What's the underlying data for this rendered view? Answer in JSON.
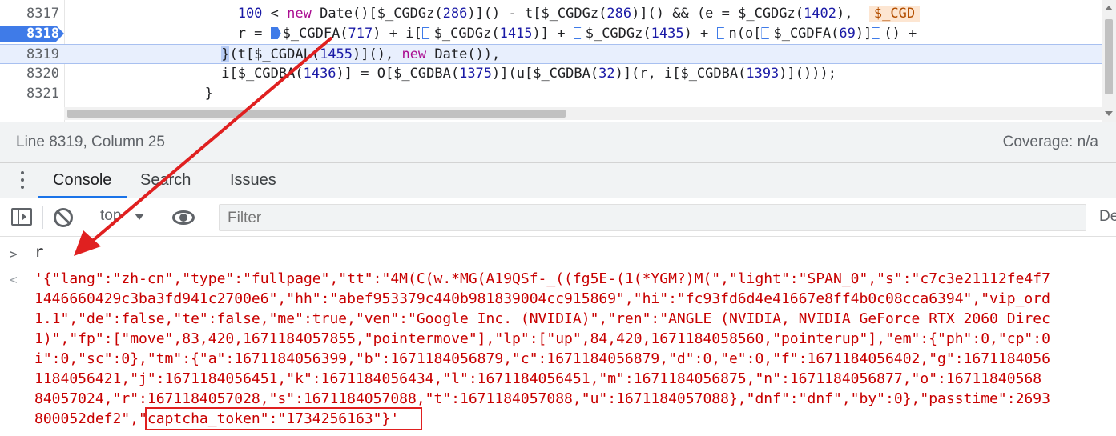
{
  "editor": {
    "lines": [
      {
        "number": "8317"
      },
      {
        "number": "8318"
      },
      {
        "number": "8319"
      },
      {
        "number": "8320"
      },
      {
        "number": "8321"
      }
    ],
    "code_8317": {
      "indent": "                    ",
      "n100": "100",
      "p1": " < ",
      "kw_new": "new",
      "p2": " Date()[$_CGDGz(",
      "n286a": "286",
      "p3": ")]() - t[$_CGDGz(",
      "n286b": "286",
      "p4": ")]() && (e = $_CGDGz(",
      "n1402": "1402",
      "p5": "),  ",
      "tag": "$_CGD"
    },
    "code_8318": {
      "indent": "                    ",
      "p1": "r = ",
      "p2": "$_CGDFA(",
      "n717": "717",
      "p3": ") + i[",
      "p4": "$_CGDGz(",
      "n1415": "1415",
      "p5": ")] + ",
      "p6": "$_CGDGz(",
      "n1435": "1435",
      "p7": ") + ",
      "p8": "n(o[",
      "p9": "$_CGDFA(",
      "n69": "69",
      "p10": ")]",
      "p11": "() +"
    },
    "code_8319": {
      "indent": "                  ",
      "brace": "}",
      "p1": "(t[$_CGDAL(",
      "n1455": "1455",
      "p2": ")](), ",
      "kw_new": "new",
      "p3": " Date()),"
    },
    "code_8320": {
      "indent": "                  ",
      "p1": "i[$_CGDBA(",
      "n1436": "1436",
      "p2": ")] = O[$_CGDBA(",
      "n1375": "1375",
      "p3": ")](u[$_CGDBA(",
      "n32": "32",
      "p4": ")](r, i[$_CGDBA(",
      "n1393": "1393",
      "p5": ")]()));"
    },
    "code_8321": {
      "indent": "                ",
      "p1": "}"
    }
  },
  "status_bar": {
    "position": "Line 8319, Column 25",
    "coverage": "Coverage: n/a"
  },
  "drawer": {
    "tabs": [
      {
        "label": "Console"
      },
      {
        "label": "Search"
      },
      {
        "label": "Issues"
      }
    ]
  },
  "toolbar": {
    "context": "top",
    "filter_placeholder": "Filter",
    "levels_label": "De"
  },
  "console": {
    "input_prompt": ">",
    "input_text": "r",
    "result_prompt": "<",
    "result_lines": [
      "'{\"lang\":\"zh-cn\",\"type\":\"fullpage\",\"tt\":\"4M(C(w.*MG(A19QSf-_((fg5E-(1(*YGM?)M(\",\"light\":\"SPAN_0\",\"s\":\"c7c3e21112fe4f7",
      "1446660429c3ba3fd941c2700e6\",\"hh\":\"abef953379c440b981839004cc915869\",\"hi\":\"fc93fd6d4e41667e8ff4b0c08cca6394\",\"vip_ord",
      "1.1\",\"de\":false,\"te\":false,\"me\":true,\"ven\":\"Google Inc. (NVIDIA)\",\"ren\":\"ANGLE (NVIDIA, NVIDIA GeForce RTX 2060 Direc",
      "1)\",\"fp\":[\"move\",83,420,1671184057855,\"pointermove\"],\"lp\":[\"up\",84,420,1671184058560,\"pointerup\"],\"em\":{\"ph\":0,\"cp\":0",
      "i\":0,\"sc\":0},\"tm\":{\"a\":1671184056399,\"b\":1671184056879,\"c\":1671184056879,\"d\":0,\"e\":0,\"f\":1671184056402,\"g\":1671184056",
      "1184056421,\"j\":1671184056451,\"k\":1671184056434,\"l\":1671184056451,\"m\":1671184056875,\"n\":1671184056877,\"o\":16711840568",
      "84057024,\"r\":1671184057028,\"s\":1671184057088,\"t\":1671184057088,\"u\":1671184057088},\"dnf\":\"dnf\",\"by\":0},\"passtime\":2693",
      "800052def2\",\"captcha_token\":\"1734256163\"}'"
    ]
  },
  "colors": {
    "annotation": "#e02020",
    "breakpoint": "#3f7be8",
    "result_text": "#c80000"
  }
}
